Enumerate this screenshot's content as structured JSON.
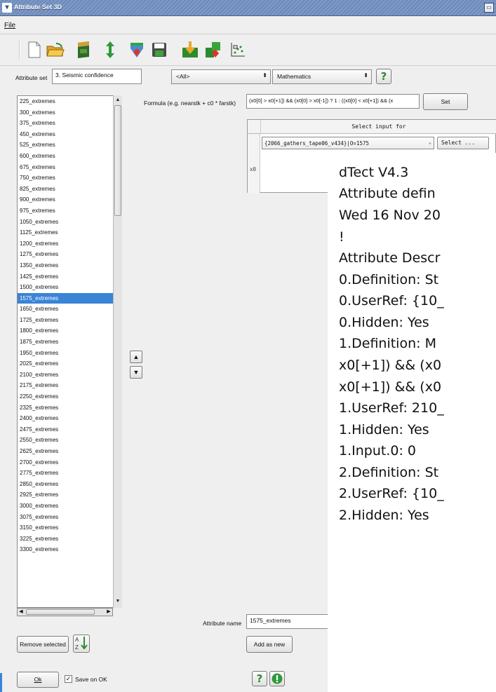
{
  "window": {
    "title": "Attribute Set 3D"
  },
  "menu": {
    "file": "File"
  },
  "toolbar": {
    "icons": [
      "new-file-icon",
      "open-folder-icon",
      "import-icon",
      "reload-icon",
      "descriptor-icon",
      "save-icon",
      "import-green-icon",
      "stack-icon",
      "crossplot-icon"
    ]
  },
  "attribute_set": {
    "label": "Attribute set",
    "value": "3. Seismic confidence"
  },
  "filter": {
    "value": "<All>"
  },
  "type": {
    "value": "Mathematics"
  },
  "attributes": [
    "225_extremes",
    "300_extremes",
    "375_extremes",
    "450_extremes",
    "525_extremes",
    "600_extremes",
    "675_extremes",
    "750_extremes",
    "825_extremes",
    "900_extremes",
    "975_extremes",
    "1050_extremes",
    "1125_extremes",
    "1200_extremes",
    "1275_extremes",
    "1350_extremes",
    "1425_extremes",
    "1500_extremes",
    "1575_extremes",
    "1650_extremes",
    "1725_extremes",
    "1800_extremes",
    "1875_extremes",
    "1950_extremes",
    "2025_extremes",
    "2100_extremes",
    "2175_extremes",
    "2250_extremes",
    "2325_extremes",
    "2400_extremes",
    "2475_extremes",
    "2550_extremes",
    "2625_extremes",
    "2700_extremes",
    "2775_extremes",
    "2850_extremes",
    "2925_extremes",
    "3000_extremes",
    "3075_extremes",
    "3150_extremes",
    "3225_extremes",
    "3300_extremes"
  ],
  "selected_attribute": "1575_extremes",
  "formula": {
    "label": "Formula (e.g. nearstk + c0 * farstk)",
    "value": "(x0[0] > x0[+1]) && (x0[0] > x0[-1]) ? 1 : ((x0[0] < x0[+1]) && (x",
    "set_label": "Set"
  },
  "input_table": {
    "header": "Select input for",
    "row_label": "x0",
    "input_value": "{2066_gathers_tape06_v434}|O=1575",
    "select_label": "Select ..."
  },
  "attribute_name": {
    "label": "Attribute name",
    "value": "1575_extremes"
  },
  "buttons": {
    "add_as_new": "Add as new",
    "remove_selected": "Remove selected",
    "ok": "Ok",
    "save_on_ok": "Save on OK"
  },
  "note_lines": [
    "dTect V4.3",
    "Attribute defin",
    "Wed 16 Nov 20",
    "!",
    "Attribute Descr",
    "0.Definition: St",
    "0.UserRef: {10_",
    "0.Hidden: Yes",
    "1.Definition: M",
    "x0[+1]) && (x0",
    "x0[+1]) && (x0",
    "1.UserRef: 210_",
    "1.Hidden: Yes",
    "1.Input.0: 0",
    "2.Definition: St",
    "2.UserRef: {10_",
    "2.Hidden: Yes"
  ]
}
